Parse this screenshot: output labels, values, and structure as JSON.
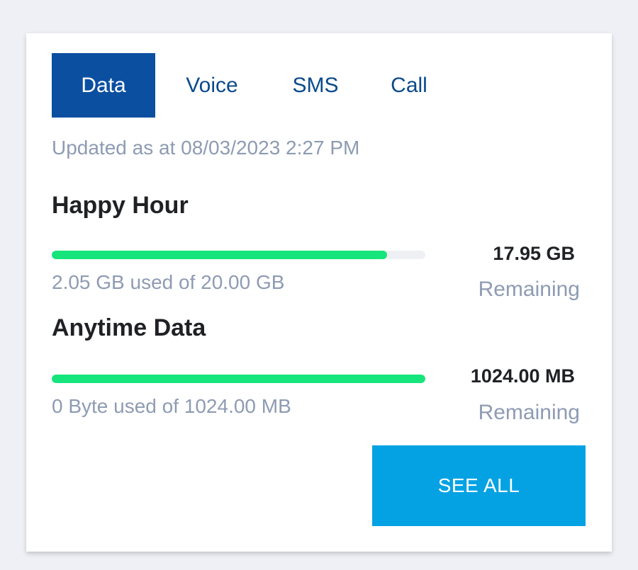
{
  "tabs": [
    {
      "label": "Data",
      "active": true
    },
    {
      "label": "Voice",
      "active": false
    },
    {
      "label": "SMS",
      "active": false
    },
    {
      "label": "Call",
      "active": false
    }
  ],
  "updated_text": "Updated as at 08/03/2023 2:27 PM",
  "plans": [
    {
      "title": "Happy Hour",
      "used_text": "2.05 GB used of 20.00 GB",
      "remaining_value": "17.95 GB",
      "remaining_label": "Remaining",
      "used_fraction": 0.1025
    },
    {
      "title": "Anytime Data",
      "used_text": "0 Byte used of 1024.00 MB",
      "remaining_value": "1024.00 MB",
      "remaining_label": "Remaining",
      "used_fraction": 0.0
    }
  ],
  "see_all_label": "SEE ALL",
  "colors": {
    "active_tab": "#0b4fa1",
    "tab_text": "#0b4a8b",
    "bar_fill": "#15e57a",
    "button": "#04a2e3",
    "muted_text": "#8e9bb3"
  }
}
